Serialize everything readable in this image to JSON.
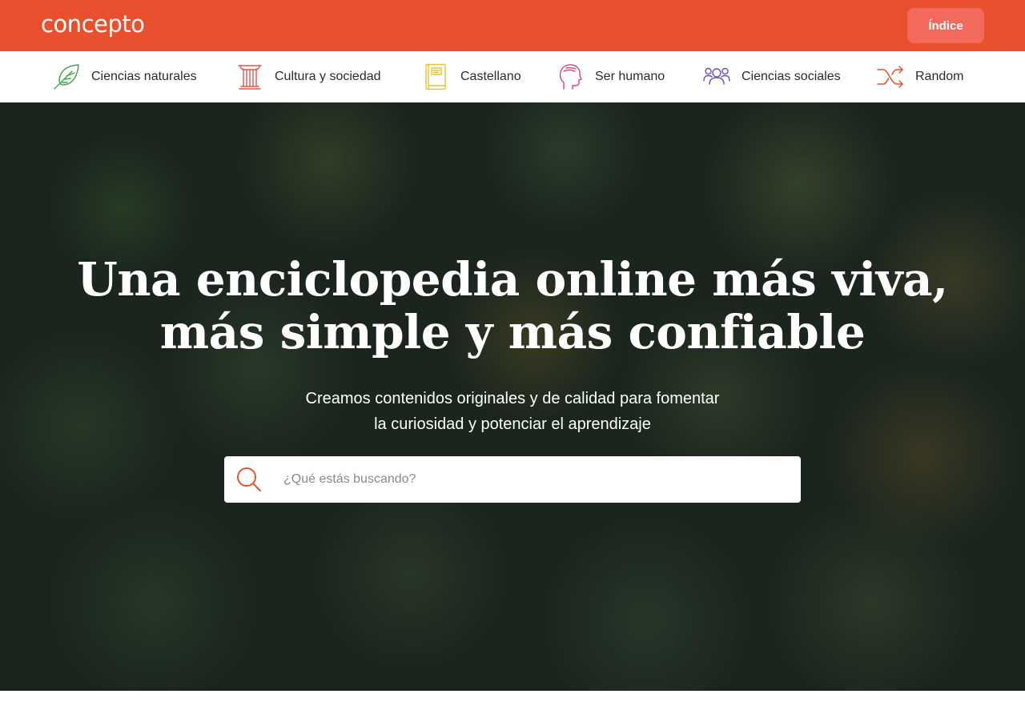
{
  "header": {
    "logo": "concepto",
    "index_button": "Índice",
    "accent_color": "#e9512e"
  },
  "categories": [
    {
      "label": "Ciencias naturales",
      "icon": "leaf-icon",
      "color": "#3ea34a"
    },
    {
      "label": "Cultura y sociedad",
      "icon": "column-icon",
      "color": "#e2574c"
    },
    {
      "label": "Castellano",
      "icon": "book-icon",
      "color": "#e8c23a"
    },
    {
      "label": "Ser humano",
      "icon": "head-icon",
      "color": "#d6408a"
    },
    {
      "label": "Ciencias sociales",
      "icon": "people-icon",
      "color": "#6a52b8"
    },
    {
      "label": "Random",
      "icon": "shuffle-icon",
      "color": "#e9512e"
    }
  ],
  "hero": {
    "headline": [
      "Una enciclopedia online más viva,",
      "más simple y más confiable"
    ],
    "subtitle": [
      "Creamos contenidos originales y de calidad para fomentar",
      "la curiosidad y potenciar el aprendizaje"
    ],
    "search_placeholder": "¿Qué estás buscando?",
    "search_value": ""
  }
}
